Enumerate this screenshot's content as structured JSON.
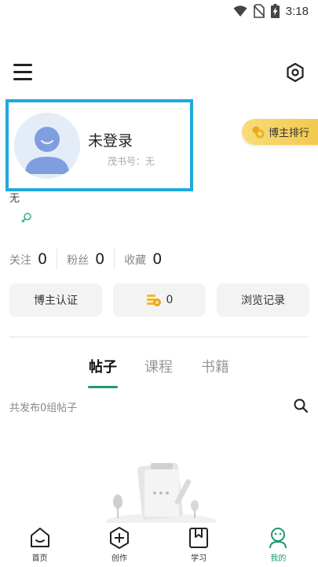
{
  "status_bar": {
    "time": "3:18",
    "icons": [
      "wifi-icon",
      "no-sim-icon",
      "battery-charging-icon"
    ]
  },
  "header": {
    "menu_icon": "hamburger-menu-icon",
    "settings_icon": "hexagon-settings-icon"
  },
  "profile": {
    "name": "未登录",
    "id_text": "茂书号：无",
    "bio": "无",
    "rank_button": "博主排行"
  },
  "stats": [
    {
      "label": "关注",
      "value": "0"
    },
    {
      "label": "粉丝",
      "value": "0"
    },
    {
      "label": "收藏",
      "value": "0"
    }
  ],
  "actions": {
    "certify": "博主认证",
    "coins": "0",
    "history": "浏览记录"
  },
  "tabs": [
    {
      "label": "帖子",
      "active": true
    },
    {
      "label": "课程",
      "active": false
    },
    {
      "label": "书籍",
      "active": false
    }
  ],
  "posts": {
    "count_text": "共发布0组帖子"
  },
  "bottom_nav": [
    {
      "label": "首页",
      "icon": "home-icon",
      "active": false
    },
    {
      "label": "创作",
      "icon": "create-plus-icon",
      "active": false
    },
    {
      "label": "学习",
      "icon": "bookmark-book-icon",
      "active": false
    },
    {
      "label": "我的",
      "icon": "profile-face-icon",
      "active": true
    }
  ],
  "colors": {
    "accent": "#1b9a74",
    "highlight_border": "#1ea9e0",
    "rank_gold": "#f3c94d"
  }
}
